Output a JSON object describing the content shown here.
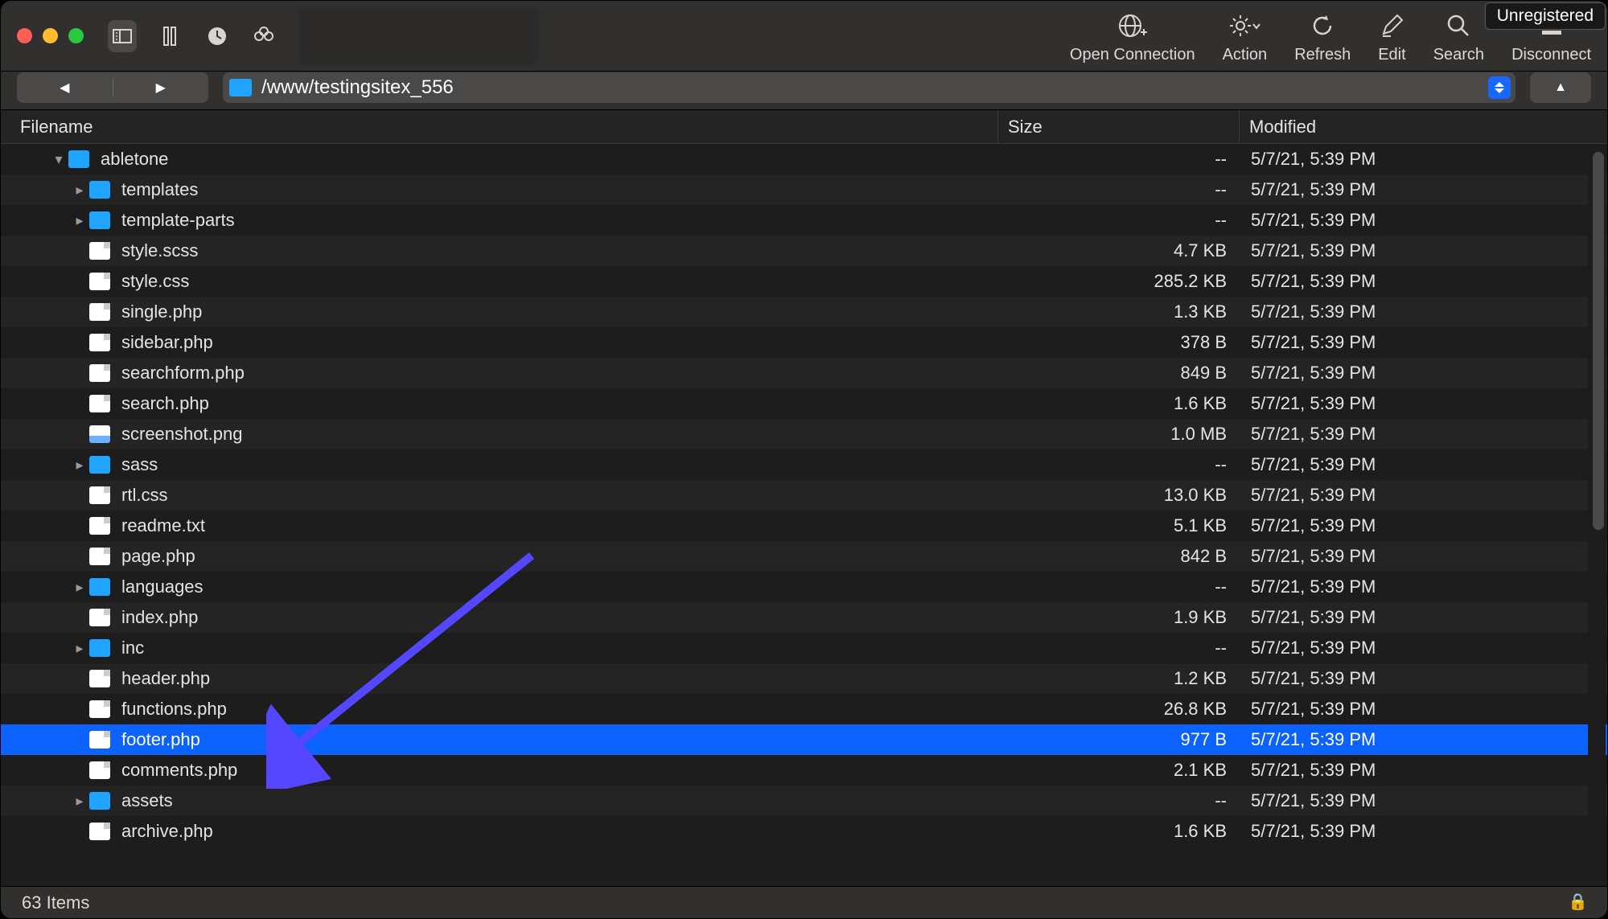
{
  "unregistered": "Unregistered",
  "toolbar": {
    "open_connection": "Open Connection",
    "action": "Action",
    "refresh": "Refresh",
    "edit": "Edit",
    "search": "Search",
    "disconnect": "Disconnect"
  },
  "path": "/www/testingsitex_556",
  "columns": {
    "filename": "Filename",
    "size": "Size",
    "modified": "Modified"
  },
  "status": "63 Items",
  "selected_index": 16,
  "rows": [
    {
      "depth": 0,
      "expand": "down",
      "type": "folder",
      "name": "abletone",
      "size": "--",
      "mod": "5/7/21, 5:39 PM"
    },
    {
      "depth": 1,
      "expand": "right",
      "type": "folder",
      "name": "templates",
      "size": "--",
      "mod": "5/7/21, 5:39 PM"
    },
    {
      "depth": 1,
      "expand": "right",
      "type": "folder",
      "name": "template-parts",
      "size": "--",
      "mod": "5/7/21, 5:39 PM"
    },
    {
      "depth": 1,
      "expand": "",
      "type": "file",
      "name": "style.scss",
      "size": "4.7 KB",
      "mod": "5/7/21, 5:39 PM"
    },
    {
      "depth": 1,
      "expand": "",
      "type": "file",
      "name": "style.css",
      "size": "285.2 KB",
      "mod": "5/7/21, 5:39 PM"
    },
    {
      "depth": 1,
      "expand": "",
      "type": "file",
      "name": "single.php",
      "size": "1.3 KB",
      "mod": "5/7/21, 5:39 PM"
    },
    {
      "depth": 1,
      "expand": "",
      "type": "file",
      "name": "sidebar.php",
      "size": "378 B",
      "mod": "5/7/21, 5:39 PM"
    },
    {
      "depth": 1,
      "expand": "",
      "type": "file",
      "name": "searchform.php",
      "size": "849 B",
      "mod": "5/7/21, 5:39 PM"
    },
    {
      "depth": 1,
      "expand": "",
      "type": "file",
      "name": "search.php",
      "size": "1.6 KB",
      "mod": "5/7/21, 5:39 PM"
    },
    {
      "depth": 1,
      "expand": "",
      "type": "img",
      "name": "screenshot.png",
      "size": "1.0 MB",
      "mod": "5/7/21, 5:39 PM"
    },
    {
      "depth": 1,
      "expand": "right",
      "type": "folder",
      "name": "sass",
      "size": "--",
      "mod": "5/7/21, 5:39 PM"
    },
    {
      "depth": 1,
      "expand": "",
      "type": "file",
      "name": "rtl.css",
      "size": "13.0 KB",
      "mod": "5/7/21, 5:39 PM"
    },
    {
      "depth": 1,
      "expand": "",
      "type": "file",
      "name": "readme.txt",
      "size": "5.1 KB",
      "mod": "5/7/21, 5:39 PM"
    },
    {
      "depth": 1,
      "expand": "",
      "type": "file",
      "name": "page.php",
      "size": "842 B",
      "mod": "5/7/21, 5:39 PM"
    },
    {
      "depth": 1,
      "expand": "right",
      "type": "folder",
      "name": "languages",
      "size": "--",
      "mod": "5/7/21, 5:39 PM"
    },
    {
      "depth": 1,
      "expand": "",
      "type": "file",
      "name": "index.php",
      "size": "1.9 KB",
      "mod": "5/7/21, 5:39 PM"
    },
    {
      "depth": 1,
      "expand": "right",
      "type": "folder",
      "name": "inc",
      "size": "--",
      "mod": "5/7/21, 5:39 PM"
    },
    {
      "depth": 1,
      "expand": "",
      "type": "file",
      "name": "header.php",
      "size": "1.2 KB",
      "mod": "5/7/21, 5:39 PM"
    },
    {
      "depth": 1,
      "expand": "",
      "type": "file",
      "name": "functions.php",
      "size": "26.8 KB",
      "mod": "5/7/21, 5:39 PM"
    },
    {
      "depth": 1,
      "expand": "",
      "type": "file",
      "name": "footer.php",
      "size": "977 B",
      "mod": "5/7/21, 5:39 PM"
    },
    {
      "depth": 1,
      "expand": "",
      "type": "file",
      "name": "comments.php",
      "size": "2.1 KB",
      "mod": "5/7/21, 5:39 PM"
    },
    {
      "depth": 1,
      "expand": "right",
      "type": "folder",
      "name": "assets",
      "size": "--",
      "mod": "5/7/21, 5:39 PM"
    },
    {
      "depth": 1,
      "expand": "",
      "type": "file",
      "name": "archive.php",
      "size": "1.6 KB",
      "mod": "5/7/21, 5:39 PM"
    }
  ]
}
